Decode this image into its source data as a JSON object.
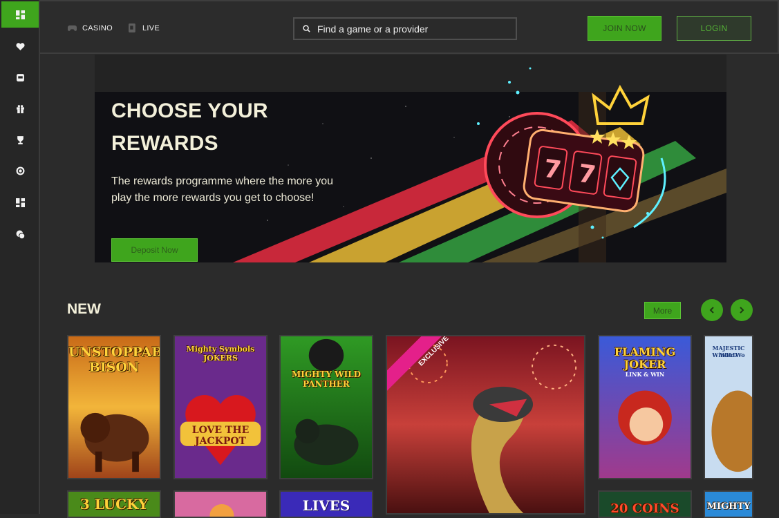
{
  "header": {
    "nav": [
      {
        "label": "CASINO",
        "icon": "gamepad-icon"
      },
      {
        "label": "LIVE",
        "icon": "live-cards-icon"
      }
    ],
    "search_placeholder": "Find a game or a provider",
    "join_label": "JOIN NOW",
    "login_label": "LOGIN"
  },
  "sidebar": {
    "items": [
      "dashboard-icon",
      "heart-icon",
      "jackpot-icon",
      "gift-icon",
      "trophy-icon",
      "target-icon",
      "grid-icon",
      "chat-icon"
    ]
  },
  "banner": {
    "title": "CHOOSE YOUR REWARDS",
    "description": "The rewards programme where the more you play the more rewards you get to choose!",
    "button_label": "Deposit Now",
    "art_reel_text": "77"
  },
  "new_section": {
    "title": "NEW",
    "more_label": "More",
    "games": [
      {
        "title": "UNSTOPPABLE BISON"
      },
      {
        "title": "Mighty Symbols JOKERS",
        "subtitle": "LOVE THE JACKPOT"
      },
      {
        "title": "MIGHTY WILD PANTHER"
      },
      {
        "title": "EXCLUSIVE",
        "badge": "EXCLUSIVE"
      },
      {
        "title": "FLAMING JOKER",
        "subtitle": "LINK & WIN"
      },
      {
        "title": "MAJESTIC WILD",
        "subtitle": "Winter Wo"
      },
      {
        "title": "3 LUCKY"
      },
      {
        "title": ""
      },
      {
        "title": "LIVES"
      },
      {
        "title": "20 COINS"
      },
      {
        "title": "MIGHTY"
      }
    ]
  },
  "colors": {
    "accent": "#3fa51d",
    "background": "#2b2b2b",
    "sidebar": "#262626",
    "title_text": "#f3f0da"
  }
}
